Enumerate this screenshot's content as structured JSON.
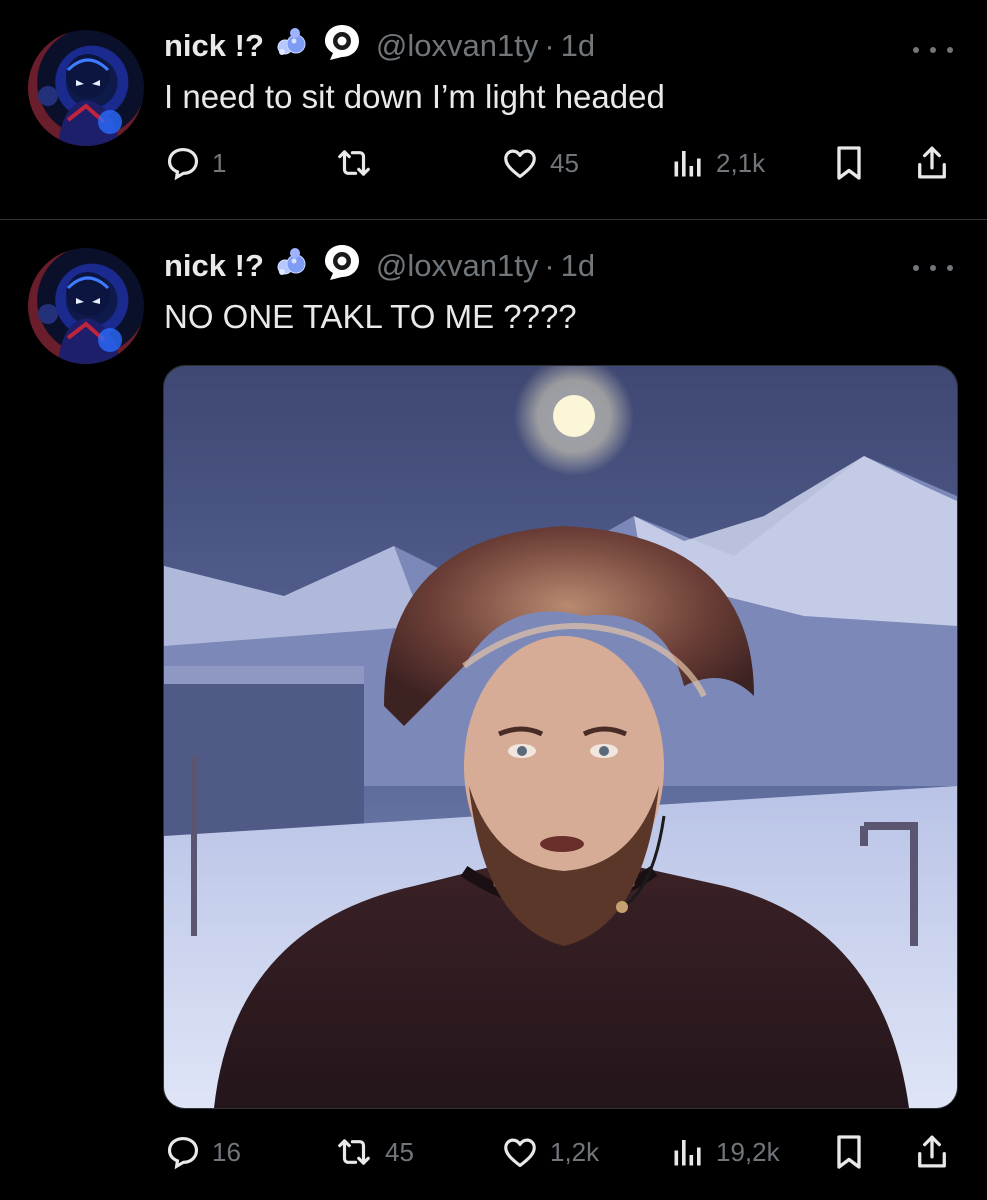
{
  "tweets": [
    {
      "author": {
        "name": "nick !?",
        "handle": "@loxvan1ty",
        "badges": [
          "bubbles-icon",
          "eye-icon"
        ]
      },
      "time": "1d",
      "text": "I need to sit down I’m light headed",
      "stats": {
        "replies": "1",
        "reposts": "",
        "likes": "45",
        "views": "2,1k"
      }
    },
    {
      "author": {
        "name": "nick !?",
        "handle": "@loxvan1ty",
        "badges": [
          "bubbles-icon",
          "eye-icon"
        ]
      },
      "time": "1d",
      "text": "NO ONE TAKL TO ME ????",
      "media": {
        "type": "photo"
      },
      "stats": {
        "replies": "16",
        "reposts": "45",
        "likes": "1,2k",
        "views": "19,2k"
      }
    }
  ],
  "separator": "·",
  "colors": {
    "background": "#000000",
    "text": "#e7e9ea",
    "muted": "#71767b",
    "divider": "#2f3336"
  }
}
